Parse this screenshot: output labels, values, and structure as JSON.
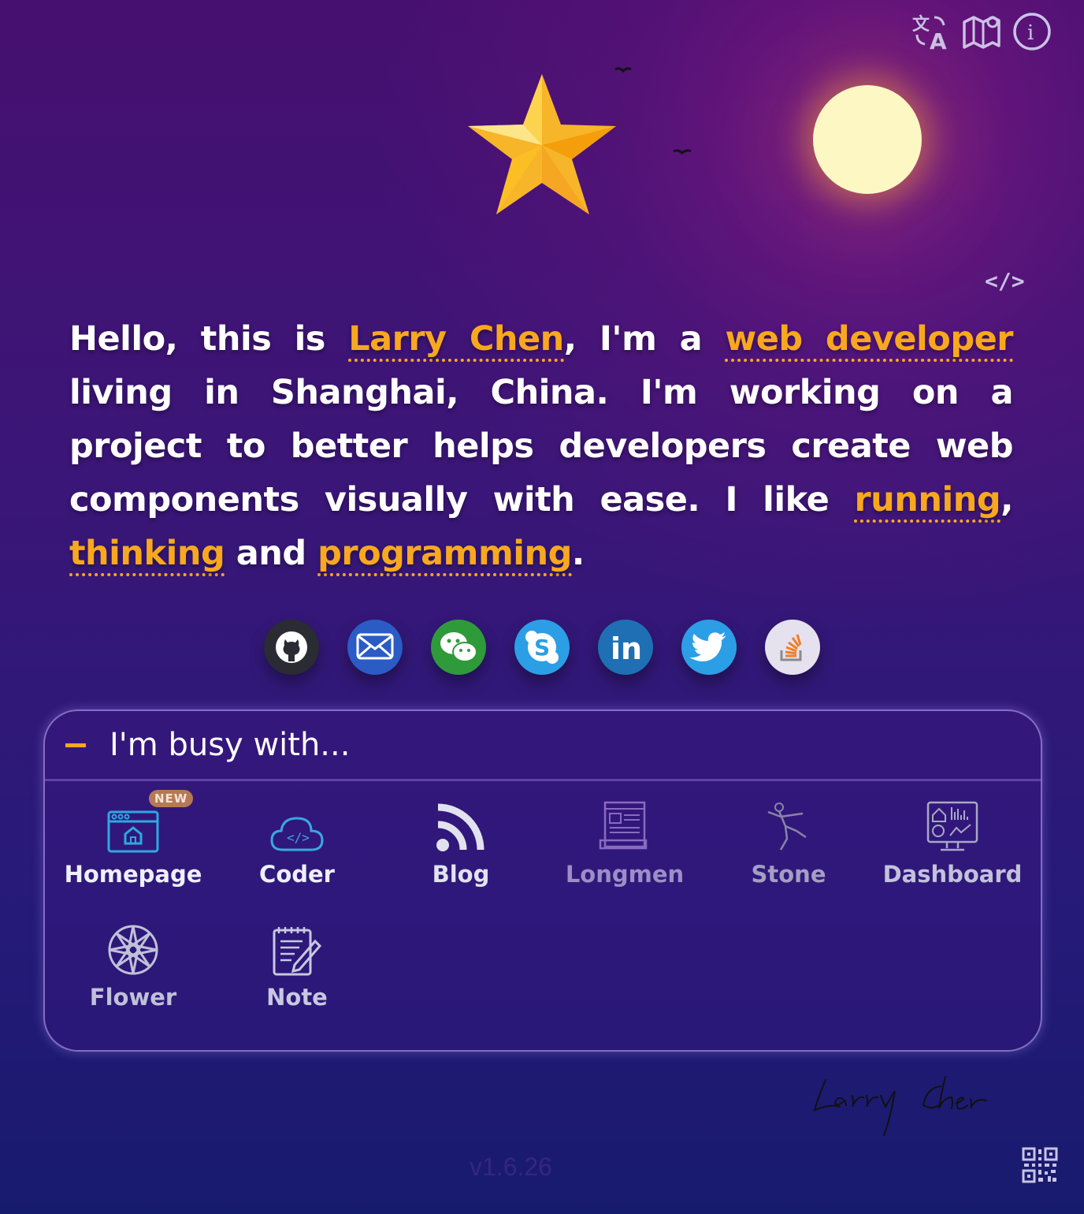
{
  "intro": {
    "p1": "Hello, this is ",
    "name": "Larry Chen",
    "p2": ", I'm a ",
    "role": "web developer",
    "p3": " living in Shanghai, China. I'm working on a project to better helps developers create web components visually with ease. I like ",
    "hobby1": "running",
    "p4": ", ",
    "hobby2": "thinking",
    "p5": " and ",
    "hobby3": "programming",
    "p6": "."
  },
  "code_tag": "</>",
  "top_icons": [
    "translate-icon",
    "map-icon",
    "info-icon"
  ],
  "socials": [
    {
      "name": "github",
      "color": "#2b2b33"
    },
    {
      "name": "email",
      "color": "#2b5bc4"
    },
    {
      "name": "wechat",
      "color": "#2f9a3a"
    },
    {
      "name": "skype",
      "color": "#2c9ee6"
    },
    {
      "name": "linkedin",
      "color": "#1f6fb5"
    },
    {
      "name": "twitter",
      "color": "#2c9ee6"
    },
    {
      "name": "stackoverflow",
      "color": "#e6e1ef"
    }
  ],
  "busy": {
    "title": "I'm busy with...",
    "items": [
      {
        "label": "Homepage",
        "badge": "NEW"
      },
      {
        "label": "Coder"
      },
      {
        "label": "Blog"
      },
      {
        "label": "Longmen"
      },
      {
        "label": "Stone"
      },
      {
        "label": "Dashboard"
      },
      {
        "label": "Flower"
      },
      {
        "label": "Note"
      }
    ]
  },
  "signature": "Larry Chen",
  "version": "v1.6.26",
  "colors": {
    "accent": "#f8a81e",
    "moon": "#fdf7c3",
    "star": "#f7b52a"
  }
}
